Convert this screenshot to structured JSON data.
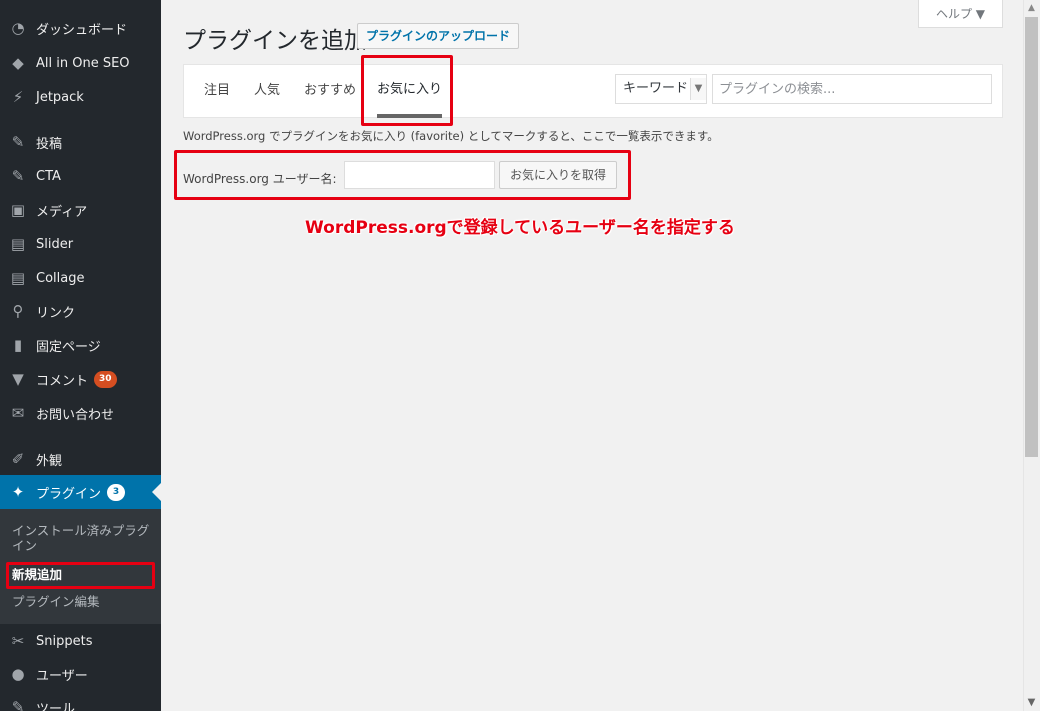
{
  "sidebar": {
    "items": [
      {
        "label": "ダッシュボード",
        "icon": "dashboard-icon",
        "glyph": "◔"
      },
      {
        "label": "All in One SEO",
        "icon": "seo-icon",
        "glyph": "◆"
      },
      {
        "label": "Jetpack",
        "icon": "jetpack-icon",
        "glyph": "⚡"
      },
      {
        "label": "投稿",
        "icon": "pin-icon",
        "glyph": "✎"
      },
      {
        "label": "CTA",
        "icon": "cta-pin-icon",
        "glyph": "✎"
      },
      {
        "label": "メディア",
        "icon": "media-icon",
        "glyph": "▣"
      },
      {
        "label": "Slider",
        "icon": "slider-icon",
        "glyph": "▤"
      },
      {
        "label": "Collage",
        "icon": "collage-icon",
        "glyph": "▤"
      },
      {
        "label": "リンク",
        "icon": "link-icon",
        "glyph": "⚲"
      },
      {
        "label": "固定ページ",
        "icon": "page-icon",
        "glyph": "▮"
      },
      {
        "label": "コメント",
        "icon": "comment-icon",
        "glyph": "▼",
        "badge": "30"
      },
      {
        "label": "お問い合わせ",
        "icon": "mail-icon",
        "glyph": "✉"
      },
      {
        "label": "外観",
        "icon": "appearance-icon",
        "glyph": "✐"
      },
      {
        "label": "プラグイン",
        "icon": "plugin-icon",
        "glyph": "✦",
        "badge": "3"
      },
      {
        "label": "Snippets",
        "icon": "snippets-icon",
        "glyph": "✂"
      },
      {
        "label": "ユーザー",
        "icon": "user-icon",
        "glyph": "●"
      },
      {
        "label": "ツール",
        "icon": "tools-icon",
        "glyph": "✎"
      }
    ],
    "submenu": [
      {
        "label": "インストール済みプラグイン"
      },
      {
        "label": "新規追加"
      },
      {
        "label": "プラグイン編集"
      }
    ]
  },
  "header": {
    "title": "プラグインを追加",
    "upload_label": "プラグインのアップロード",
    "help_label": "ヘルプ ▼"
  },
  "tabs": [
    {
      "label": "注目"
    },
    {
      "label": "人気"
    },
    {
      "label": "おすすめ"
    },
    {
      "label": "お気に入り"
    }
  ],
  "search": {
    "type_value": "キーワード",
    "placeholder": "プラグインの検索..."
  },
  "favorites": {
    "description": "WordPress.org でプラグインをお気に入り (favorite) としてマークすると、ここで一覧表示できます。",
    "user_label": "WordPress.org ユーザー名:",
    "user_value": "",
    "button_label": "お気に入りを取得"
  },
  "annotation": "WordPress.orgで登録しているユーザー名を指定する",
  "colors": {
    "sidebar_bg": "#23282d",
    "accent": "#0073aa",
    "annotation_red": "#e60012"
  }
}
